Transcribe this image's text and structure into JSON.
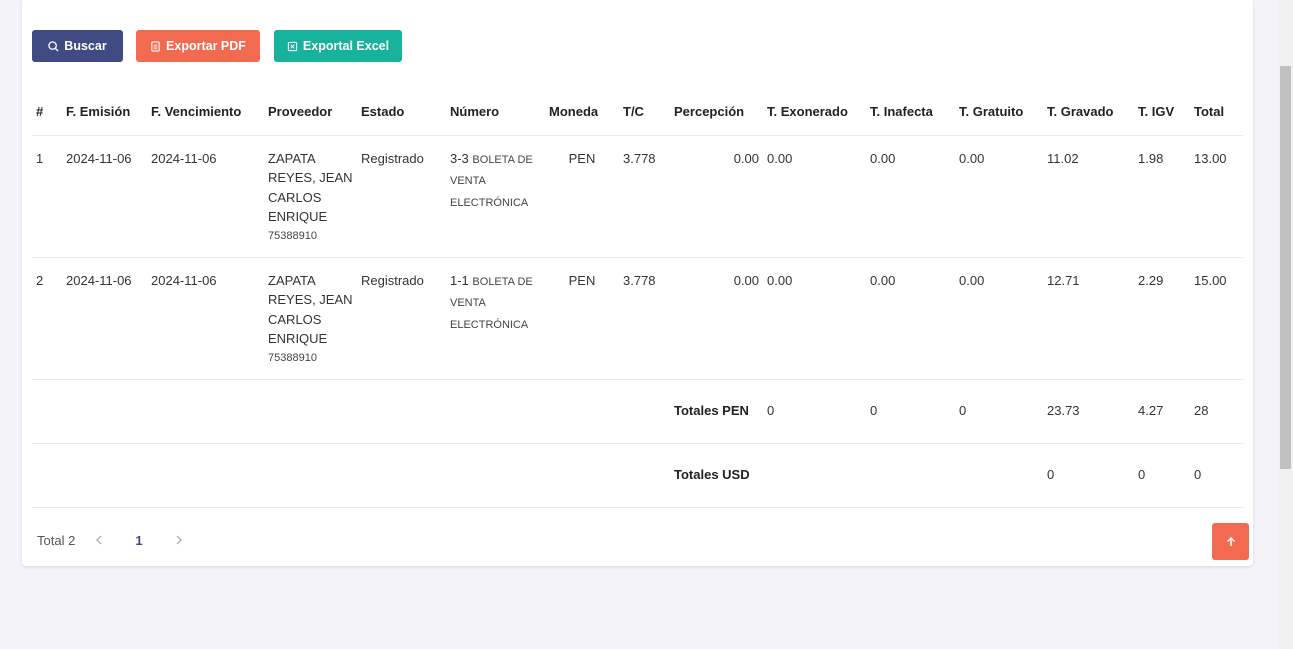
{
  "toolbar": {
    "buscar_label": "Buscar",
    "pdf_label": "Exportar PDF",
    "excel_label": "Exportal Excel"
  },
  "columns": [
    "#",
    "F. Emisión",
    "F. Vencimiento",
    "Proveedor",
    "Estado",
    "Número",
    "Moneda",
    "T/C",
    "Percepción",
    "T. Exonerado",
    "T. Inafecta",
    "T. Gratuito",
    "T. Gravado",
    "T. IGV",
    "Total"
  ],
  "rows": [
    {
      "index": "1",
      "emision": "2024-11-06",
      "vencimiento": "2024-11-06",
      "proveedor": "ZAPATA REYES, JEAN CARLOS ENRIQUE",
      "proveedor_doc": "75388910",
      "estado": "Registrado",
      "numero": "3-3",
      "numero_tipo": "BOLETA DE VENTA ELECTRÓNICA",
      "moneda": "PEN",
      "tc": "3.778",
      "percepcion": "0.00",
      "exonerado": "0.00",
      "inafecta": "0.00",
      "gratuito": "0.00",
      "gravado": "11.02",
      "igv": "1.98",
      "total": "13.00"
    },
    {
      "index": "2",
      "emision": "2024-11-06",
      "vencimiento": "2024-11-06",
      "proveedor": "ZAPATA REYES, JEAN CARLOS ENRIQUE",
      "proveedor_doc": "75388910",
      "estado": "Registrado",
      "numero": "1-1",
      "numero_tipo": "BOLETA DE VENTA ELECTRÓNICA",
      "moneda": "PEN",
      "tc": "3.778",
      "percepcion": "0.00",
      "exonerado": "0.00",
      "inafecta": "0.00",
      "gratuito": "0.00",
      "gravado": "12.71",
      "igv": "2.29",
      "total": "15.00"
    }
  ],
  "totals_pen": {
    "label": "Totales PEN",
    "exonerado": "0",
    "inafecta": "0",
    "gratuito": "0",
    "gravado": "23.73",
    "igv": "4.27",
    "total": "28"
  },
  "totals_usd": {
    "label": "Totales USD",
    "gravado": "0",
    "igv": "0",
    "total": "0"
  },
  "pagination": {
    "total_label": "Total 2",
    "current_page": "1"
  },
  "colors": {
    "primary": "#3f4b82",
    "danger": "#f26a50",
    "success": "#17b29b"
  }
}
